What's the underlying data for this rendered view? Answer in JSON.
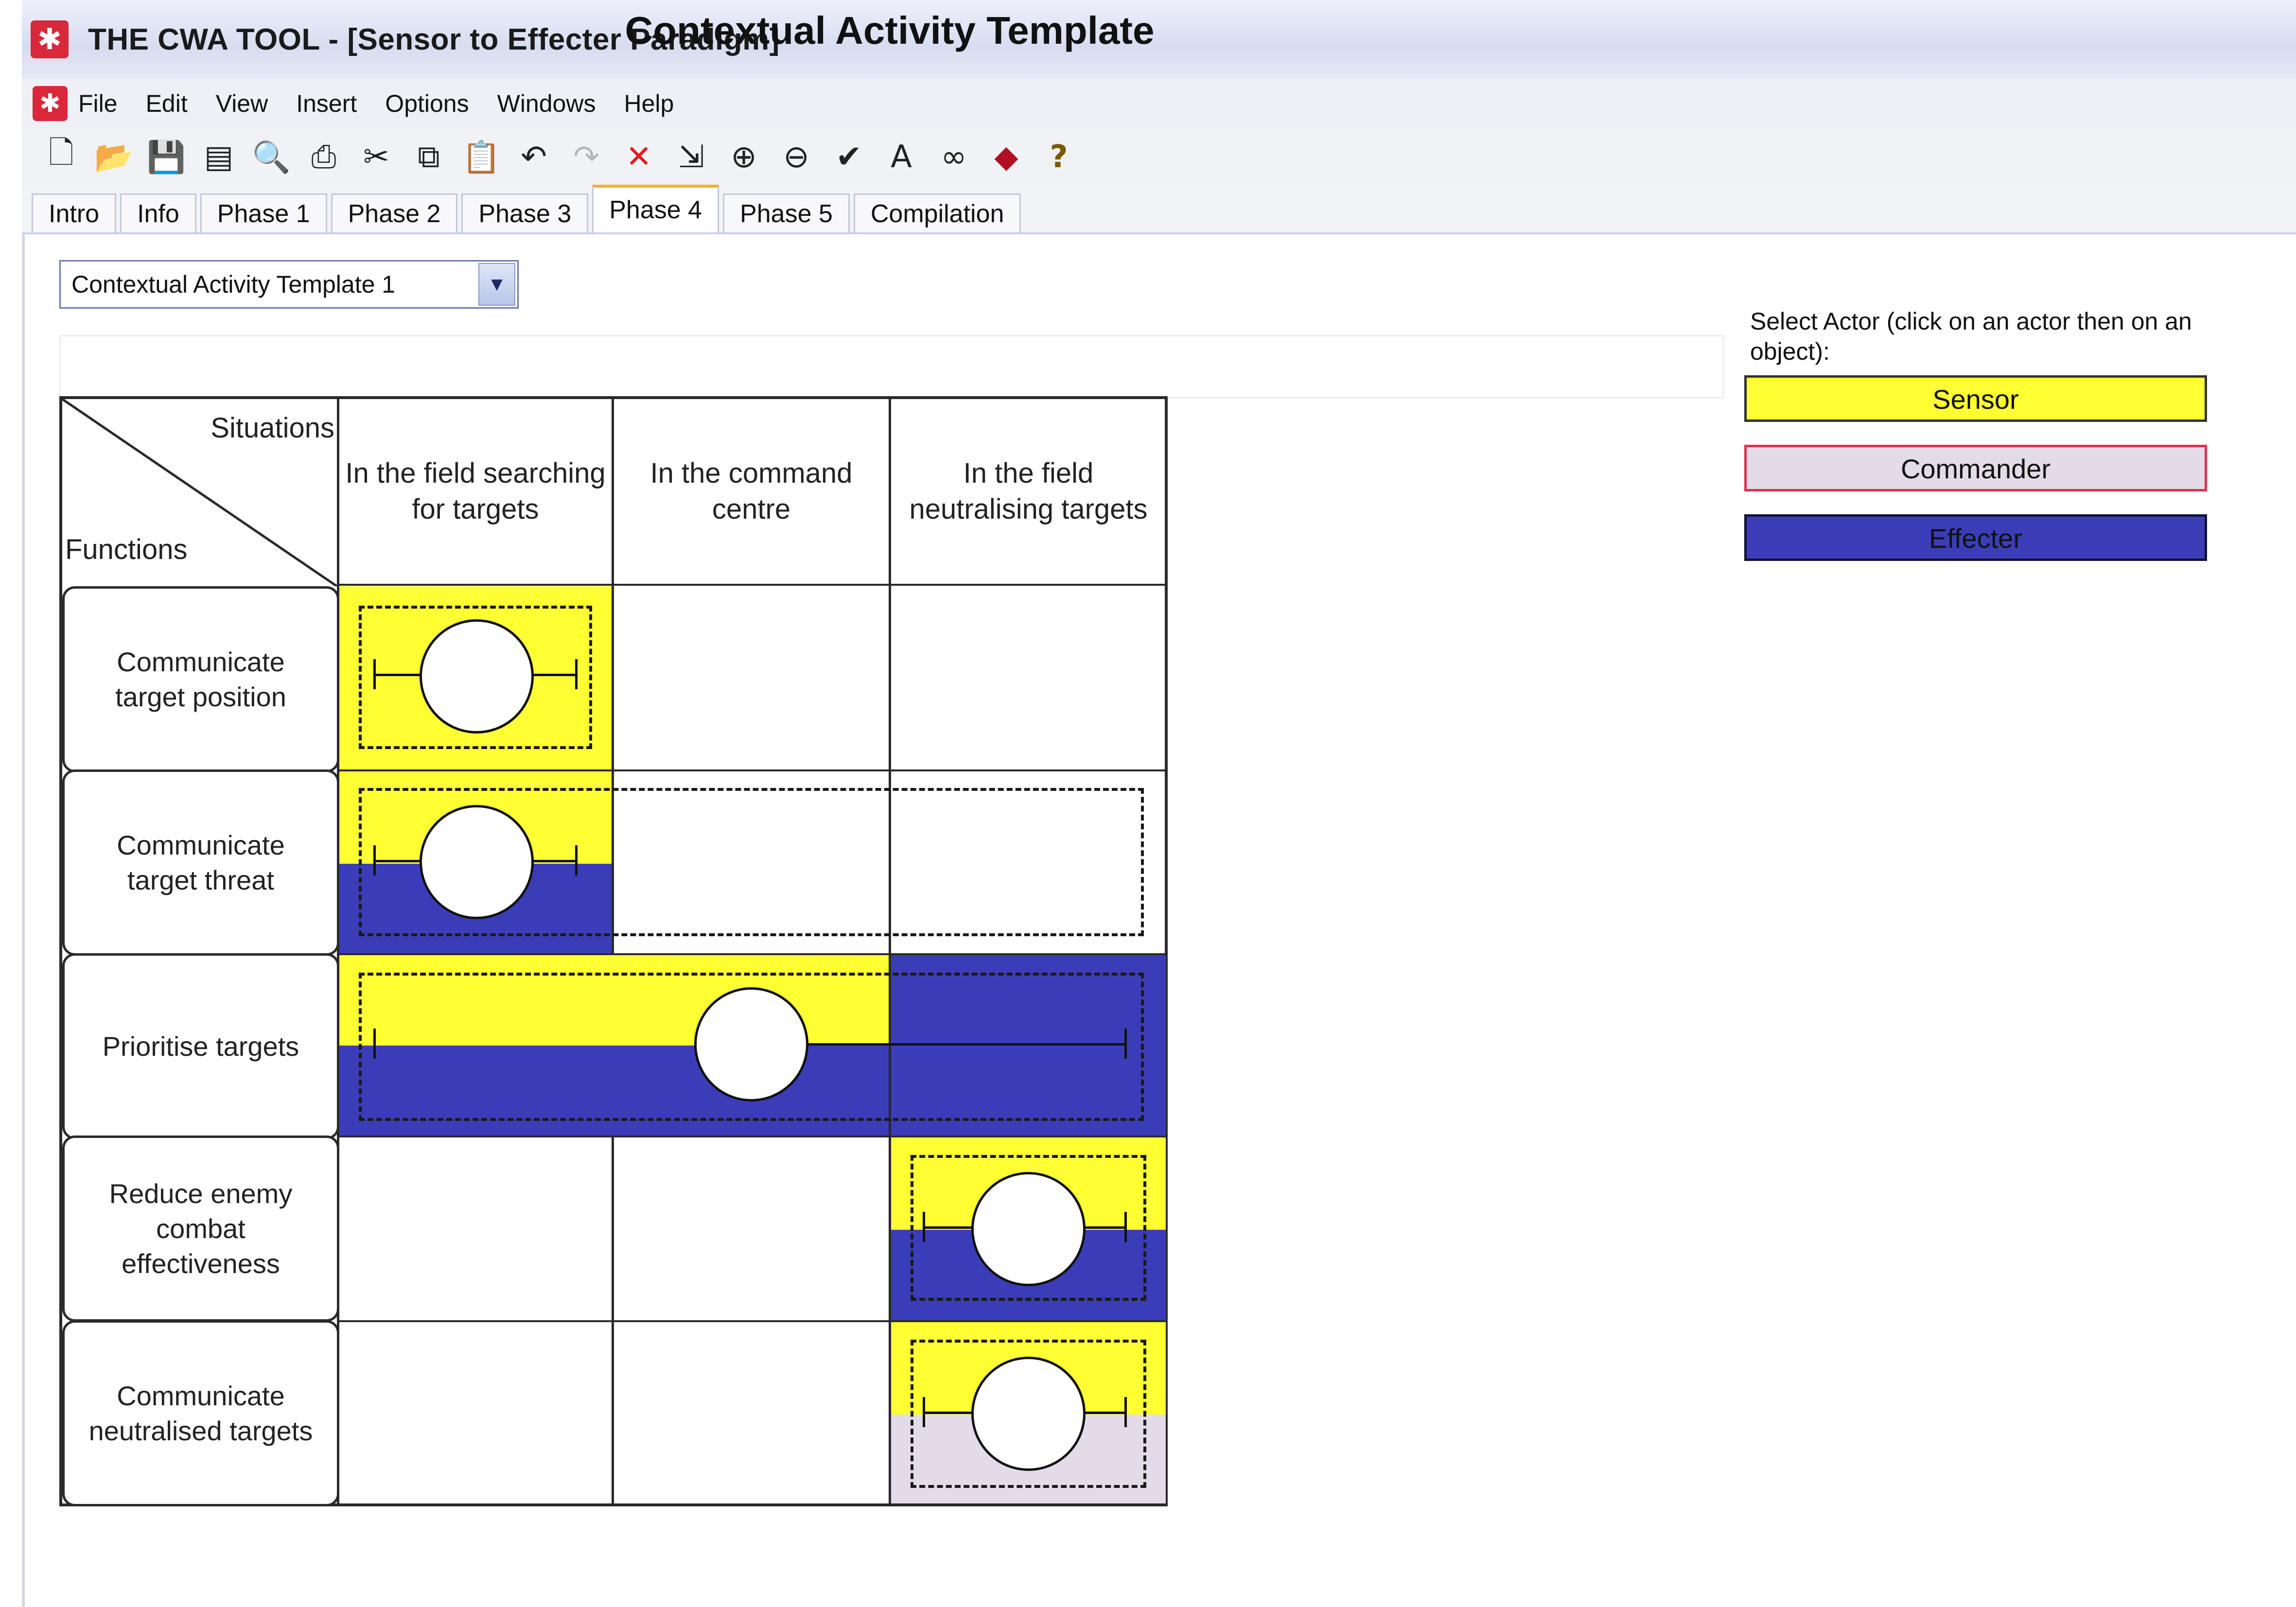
{
  "window": {
    "title": "THE CWA TOOL - [Sensor to Effecter Paradigm]"
  },
  "menu": [
    "File",
    "Edit",
    "View",
    "Insert",
    "Options",
    "Windows",
    "Help"
  ],
  "toolbar_icons": [
    "new-document-icon",
    "open-folder-icon",
    "save-icon",
    "copy-page-icon",
    "print-preview-icon",
    "print-icon",
    "cut-icon",
    "copy-icon",
    "paste-icon",
    "undo-icon",
    "redo-icon",
    "delete-icon",
    "import-icon",
    "zoom-in-icon",
    "zoom-out-icon",
    "spellcheck-icon",
    "text-icon",
    "binoculars-icon",
    "book-icon",
    "help-icon"
  ],
  "tabs": [
    "Intro",
    "Info",
    "Phase 1",
    "Phase 2",
    "Phase 3",
    "Phase 4",
    "Phase 5",
    "Compilation"
  ],
  "active_tab": "Phase 4",
  "template_select": {
    "value": "Contextual Activity Template 1"
  },
  "cat": {
    "title": "Contextual Activity Template",
    "corner_situations": "Situations",
    "corner_functions": "Functions",
    "situations": [
      "In the field searching for targets",
      "In the command centre",
      "In the field neutralising targets"
    ],
    "functions": [
      "Communicate target position",
      "Communicate target threat",
      "Prioritise targets",
      "Reduce enemy combat effectiveness",
      "Communicate neutralised targets"
    ]
  },
  "actors": {
    "instruction": "Select Actor (click on an actor then on an object):",
    "items": [
      {
        "label": "Sensor",
        "color": "#ffff33",
        "text_color": "#111111",
        "border": "#333333"
      },
      {
        "label": "Commander",
        "color": "#e3dce8",
        "text_color": "#111111",
        "border": "#e03050"
      },
      {
        "label": "Effecter",
        "color": "#3b3db8",
        "text_color": "#111111",
        "border": "#111133"
      }
    ]
  },
  "colors": {
    "sensor": "#ffff33",
    "commander": "#e3dce8",
    "effecter": "#3b3db8"
  }
}
